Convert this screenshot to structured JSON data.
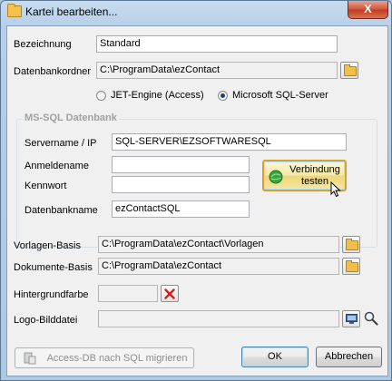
{
  "window": {
    "title": "Kartei bearbeiten...",
    "close_label": "X"
  },
  "form": {
    "bezeichnung": {
      "label": "Bezeichnung",
      "value": "Standard"
    },
    "datenbankordner": {
      "label": "Datenbankordner",
      "value": "C:\\ProgramData\\ezContact"
    },
    "engine": {
      "jet_label": "JET-Engine (Access)",
      "sql_label": "Microsoft SQL-Server",
      "selected": "Microsoft SQL-Server"
    }
  },
  "mssql": {
    "group_title": "MS-SQL Datenbank",
    "servername": {
      "label": "Servername / IP",
      "value": "SQL-SERVER\\EZSOFTWARESQL"
    },
    "anmeldename": {
      "label": "Anmeldename",
      "value": ""
    },
    "kennwort": {
      "label": "Kennwort",
      "value": ""
    },
    "datenbankname": {
      "label": "Datenbankname",
      "value": "ezContactSQL"
    },
    "test_button_line1": "Verbindung",
    "test_button_line2": "testen"
  },
  "paths": {
    "vorlagen": {
      "label": "Vorlagen-Basis",
      "value": "C:\\ProgramData\\ezContact\\Vorlagen"
    },
    "dokumente": {
      "label": "Dokumente-Basis",
      "value": "C:\\ProgramData\\ezContact"
    },
    "hintergrundfarbe": {
      "label": "Hintergrundfarbe",
      "value": ""
    },
    "logo": {
      "label": "Logo-Bilddatei",
      "value": ""
    }
  },
  "buttons": {
    "migrate": "Access-DB nach SQL migrieren",
    "ok": "OK",
    "cancel": "Abbrechen"
  },
  "colors": {
    "accent_green": "#2e9e2e",
    "clear_red": "#d42020",
    "title_bar": "#b9d1ea"
  },
  "icons": [
    "folder-icon",
    "globe-check-icon",
    "clear-x-icon",
    "monitor-icon",
    "magnifier-icon",
    "database-icon",
    "mouse-cursor-icon"
  ]
}
